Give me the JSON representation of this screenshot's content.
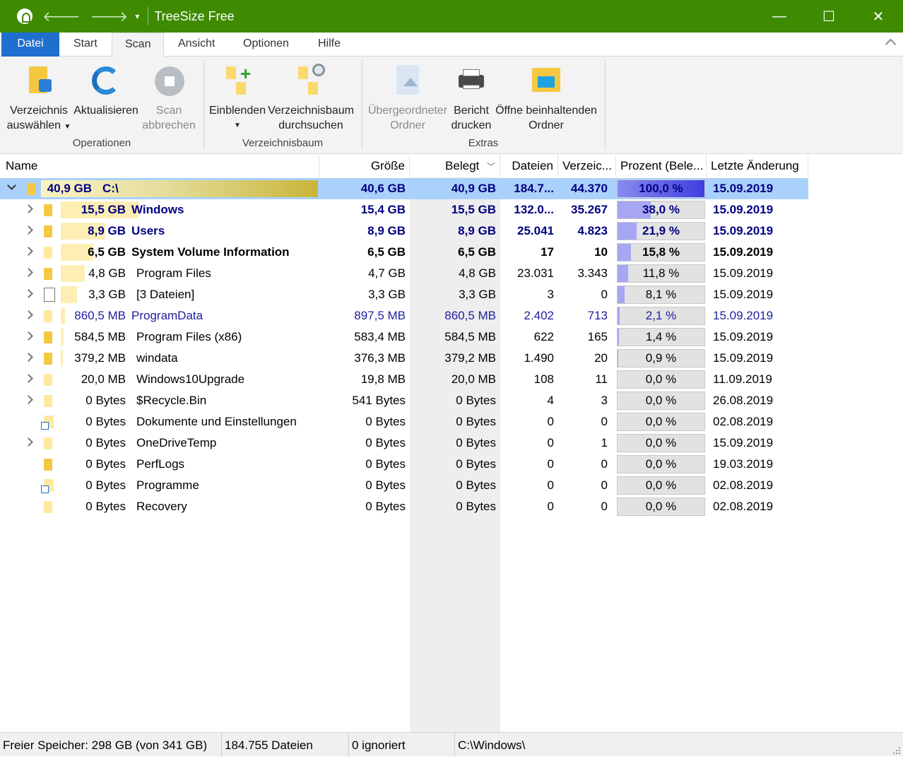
{
  "window": {
    "title": "TreeSize Free",
    "min_glyph": "—",
    "max_glyph": "☐",
    "close_glyph": "✕"
  },
  "tabs": [
    "Datei",
    "Start",
    "Scan",
    "Ansicht",
    "Optionen",
    "Hilfe"
  ],
  "active_tab": "Scan",
  "ribbon": {
    "operationen": {
      "label": "Operationen",
      "select_dir": [
        "Verzeichnis",
        "auswählen"
      ],
      "refresh": "Aktualisieren",
      "cancel": [
        "Scan",
        "abbrechen"
      ]
    },
    "verzeichnisbaum": {
      "label": "Verzeichnisbaum",
      "expand": "Einblenden",
      "search": [
        "Verzeichnisbaum",
        "durchsuchen"
      ]
    },
    "extras": {
      "label": "Extras",
      "parent": [
        "Übergeordneter",
        "Ordner"
      ],
      "print": [
        "Bericht",
        "drucken"
      ],
      "open": [
        "Öffne beinhaltenden",
        "Ordner"
      ]
    }
  },
  "columns": {
    "name": "Name",
    "size": "Größe",
    "alloc": "Belegt",
    "files": "Dateien",
    "dirs": "Verzeic...",
    "percent": "Prozent (Bele...",
    "modified": "Letzte Änderung"
  },
  "rows": [
    {
      "size_label": "40,9 GB",
      "name": "C:\\",
      "size": "40,6 GB",
      "alloc": "40,9 GB",
      "files": "184.7...",
      "dirs": "44.370",
      "pct": "100,0 %",
      "pct_value": 100.0,
      "modified": "15.09.2019"
    },
    {
      "size_label": "15,5 GB",
      "name": "Windows",
      "size": "15,4 GB",
      "alloc": "15,5 GB",
      "files": "132.0...",
      "dirs": "35.267",
      "pct": "38,0 %",
      "pct_value": 38.0,
      "modified": "15.09.2019"
    },
    {
      "size_label": "8,9 GB",
      "name": "Users",
      "size": "8,9 GB",
      "alloc": "8,9 GB",
      "files": "25.041",
      "dirs": "4.823",
      "pct": "21,9 %",
      "pct_value": 21.9,
      "modified": "15.09.2019"
    },
    {
      "size_label": "6,5 GB",
      "name": "System Volume Information",
      "size": "6,5 GB",
      "alloc": "6,5 GB",
      "files": "17",
      "dirs": "10",
      "pct": "15,8 %",
      "pct_value": 15.8,
      "modified": "15.09.2019"
    },
    {
      "size_label": "4,8 GB",
      "name": "Program Files",
      "size": "4,7 GB",
      "alloc": "4,8 GB",
      "files": "23.031",
      "dirs": "3.343",
      "pct": "11,8 %",
      "pct_value": 11.8,
      "modified": "15.09.2019"
    },
    {
      "size_label": "3,3 GB",
      "name": "[3 Dateien]",
      "size": "3,3 GB",
      "alloc": "3,3 GB",
      "files": "3",
      "dirs": "0",
      "pct": "8,1 %",
      "pct_value": 8.1,
      "modified": "15.09.2019"
    },
    {
      "size_label": "860,5 MB",
      "name": "ProgramData",
      "size": "897,5 MB",
      "alloc": "860,5 MB",
      "files": "2.402",
      "dirs": "713",
      "pct": "2,1 %",
      "pct_value": 2.1,
      "modified": "15.09.2019"
    },
    {
      "size_label": "584,5 MB",
      "name": "Program Files (x86)",
      "size": "583,4 MB",
      "alloc": "584,5 MB",
      "files": "622",
      "dirs": "165",
      "pct": "1,4 %",
      "pct_value": 1.4,
      "modified": "15.09.2019"
    },
    {
      "size_label": "379,2 MB",
      "name": "windata",
      "size": "376,3 MB",
      "alloc": "379,2 MB",
      "files": "1.490",
      "dirs": "20",
      "pct": "0,9 %",
      "pct_value": 0.9,
      "modified": "15.09.2019"
    },
    {
      "size_label": "20,0 MB",
      "name": "Windows10Upgrade",
      "size": "19,8 MB",
      "alloc": "20,0 MB",
      "files": "108",
      "dirs": "11",
      "pct": "0,0 %",
      "pct_value": 0.0,
      "modified": "11.09.2019"
    },
    {
      "size_label": "0 Bytes",
      "name": "$Recycle.Bin",
      "size": "541 Bytes",
      "alloc": "0 Bytes",
      "files": "4",
      "dirs": "3",
      "pct": "0,0 %",
      "pct_value": 0.0,
      "modified": "26.08.2019"
    },
    {
      "size_label": "0 Bytes",
      "name": "Dokumente und Einstellungen",
      "size": "0 Bytes",
      "alloc": "0 Bytes",
      "files": "0",
      "dirs": "0",
      "pct": "0,0 %",
      "pct_value": 0.0,
      "modified": "02.08.2019"
    },
    {
      "size_label": "0 Bytes",
      "name": "OneDriveTemp",
      "size": "0 Bytes",
      "alloc": "0 Bytes",
      "files": "0",
      "dirs": "1",
      "pct": "0,0 %",
      "pct_value": 0.0,
      "modified": "15.09.2019"
    },
    {
      "size_label": "0 Bytes",
      "name": "PerfLogs",
      "size": "0 Bytes",
      "alloc": "0 Bytes",
      "files": "0",
      "dirs": "0",
      "pct": "0,0 %",
      "pct_value": 0.0,
      "modified": "19.03.2019"
    },
    {
      "size_label": "0 Bytes",
      "name": "Programme",
      "size": "0 Bytes",
      "alloc": "0 Bytes",
      "files": "0",
      "dirs": "0",
      "pct": "0,0 %",
      "pct_value": 0.0,
      "modified": "02.08.2019"
    },
    {
      "size_label": "0 Bytes",
      "name": "Recovery",
      "size": "0 Bytes",
      "alloc": "0 Bytes",
      "files": "0",
      "dirs": "0",
      "pct": "0,0 %",
      "pct_value": 0.0,
      "modified": "02.08.2019"
    }
  ],
  "status": {
    "free": "Freier Speicher: 298 GB  (von 341 GB)",
    "files": "184.755  Dateien",
    "ignored": "0 ignoriert",
    "path": "C:\\Windows\\"
  },
  "colors": {
    "titlebar": "#3e8a00",
    "file_tab": "#1f6fce",
    "selection": "#a9d1fb",
    "percent_fill": "#a6a6f2"
  }
}
